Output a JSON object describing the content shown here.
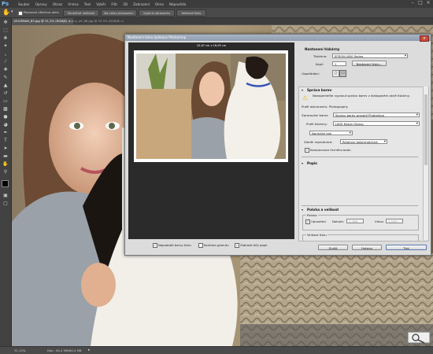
{
  "app": {
    "logo": "Ps"
  },
  "menubar": {
    "items": [
      "Soubor",
      "Úpravy",
      "Obraz",
      "Vrstva",
      "Text",
      "Výběr",
      "Filtr",
      "3D",
      "Zobrazení",
      "Okna",
      "Nápověda"
    ]
  },
  "optionsbar": {
    "tool_label": "Posouvat všechna okna",
    "buttons": [
      "Skutečné velikosti",
      "Na celou obrazovku",
      "Vyplnit obrazovku",
      "Velikost tisku"
    ]
  },
  "tabs": [
    {
      "label": "1810SRAN_83.jpg @ 31,2% (RGB/8)",
      "active": true
    },
    {
      "label": "sony_a9_88.jpg @ 33,3% (RGB/8)",
      "active": false
    }
  ],
  "status": {
    "zoom": "31,15%",
    "doc": "Dok.: 60,4 MB/60,4 MB"
  },
  "dialog": {
    "title": "Nastavení tisku aplikace Photoshop",
    "preview_size": "25,67 cm x 18,09 cm",
    "printer_section": {
      "header": "Nastavení tiskárny",
      "printer_label": "Tiskárna:",
      "printer_value": "EPSON L800 Series",
      "copies_label": "Kopií:",
      "copies_value": "1",
      "print_settings_button": "Nastavení tisku...",
      "layout_label": "Uspořádání:"
    },
    "color": {
      "header": "Správa barev",
      "warning": "Nezapomeňte vypnout správu barev v dialogovém okně tiskárny.",
      "profile_doc": "Profil dokumentu: Photography",
      "handling_label": "Zpracování barev:",
      "handling_value": "Správu barev provádí Photoshop",
      "printer_profile_label": "Profil tiskárny:",
      "printer_profile_value": "L800 Epson Glossy",
      "mode_value": "Normální tisk",
      "intent_label": "Záměr reprodukce:",
      "intent_value": "Relativní kolorimetrická",
      "bpc_label": "Kompenzace černého bodu"
    },
    "description": {
      "header": "Popis"
    },
    "position": {
      "header": "Poloha a velikost",
      "group_label": "Poloha",
      "center_label": "Uprostřed",
      "top_label": "Nahoře:",
      "top_value": "1,706",
      "left_label": "Vlevo:",
      "left_value": "1,109",
      "scaled_label": "Velikost tisku"
    },
    "bottom_checks": {
      "match_colors": "Napodobit barvy tisku",
      "gamut": "Kontrola gamutu",
      "paper_white": "Zobrazit bílý papír"
    },
    "buttons": {
      "cancel": "Zrušit",
      "done": "Hotovo",
      "print": "Tisk"
    }
  },
  "colors": {
    "accent": "#7ab8ea",
    "workspace": "#535353",
    "dialog": "#dcdcdc"
  }
}
